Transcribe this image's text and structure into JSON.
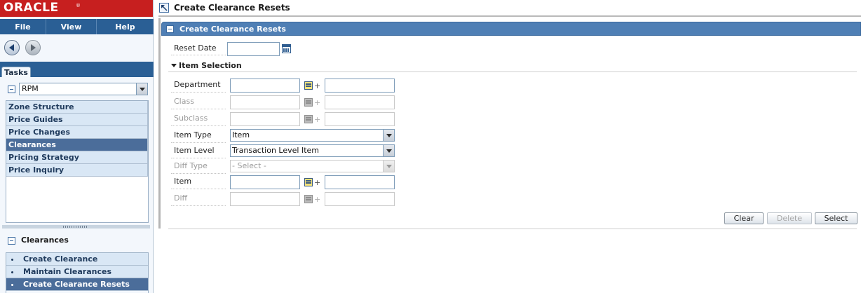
{
  "app": {
    "logo": "ORACLE",
    "logo_mark": "®",
    "menu": [
      "File",
      "View",
      "Help"
    ]
  },
  "tasks": {
    "tab_label": "Tasks",
    "selected_app": "RPM",
    "items": [
      "Zone Structure",
      "Price Guides",
      "Price Changes",
      "Clearances",
      "Pricing Strategy",
      "Price Inquiry"
    ],
    "active_item": "Clearances"
  },
  "clearances": {
    "title": "Clearances",
    "items": [
      "Create Clearance",
      "Maintain Clearances",
      "Create Clearance Resets"
    ],
    "active_item": "Create Clearance Resets"
  },
  "page": {
    "title": "Create Clearance Resets",
    "panel_title": "Create Clearance Resets"
  },
  "form": {
    "reset_date_label": "Reset Date",
    "reset_date_value": "",
    "section_title": "Item Selection",
    "department_label": "Department",
    "class_label": "Class",
    "subclass_label": "Subclass",
    "item_type_label": "Item Type",
    "item_type_value": "Item",
    "item_level_label": "Item Level",
    "item_level_value": "Transaction Level Item",
    "diff_type_label": "Diff Type",
    "diff_type_value": "- Select -",
    "item_label": "Item",
    "diff_label": "Diff",
    "plus": "+"
  },
  "buttons": {
    "clear": "Clear",
    "delete": "Delete",
    "select": "Select"
  },
  "colors": {
    "brand": "#c71f1f",
    "menubar": "#2a5f95",
    "panel_header": "#4f7fb5",
    "active_task": "#4b6d9a"
  }
}
